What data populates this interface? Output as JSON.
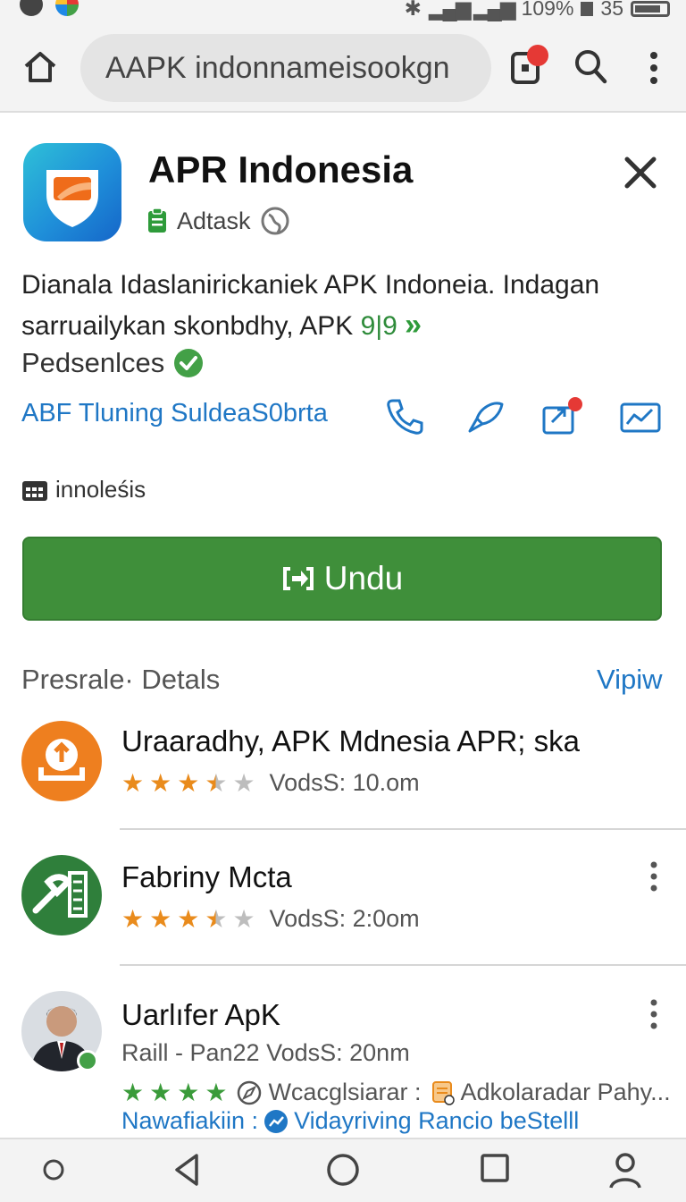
{
  "status_bar": {
    "battery_text": "109%",
    "time_text": "35"
  },
  "browser": {
    "url_text": "AAPK indonnameisookgn"
  },
  "app": {
    "title": "APR Indonesia",
    "developer": "Adtask",
    "description": "Dianala Idaslanirickaniek APK Indoneia. Indagan sarruailykan skonbdhy, APK",
    "description_highlight": "9|9",
    "badge_text": "Pedsenlces",
    "link_text": "ABF Tluning SuldeaS0brta",
    "language": "innoleśis",
    "install_label": "Undu"
  },
  "section": {
    "title": "Presrale· Detals",
    "link": "Vipiw"
  },
  "items": [
    {
      "title": "Uraaradhy, APK Mdnesia APR; ska",
      "rating": 3.5,
      "meta": "VodsS: 10.om"
    },
    {
      "title": "Fabriny Mcta",
      "rating": 3.5,
      "meta": "VodsS: 2:0om"
    },
    {
      "title": "Uarlıfer ApK",
      "subtitle": "Raill - Pan22  VodsS: 20nm",
      "rating": 4,
      "extra1": "Wcacglsiarar :",
      "extra2": "Adkolaradar Pahy...",
      "line_label": "Nawafiakiin :",
      "line_value": "Vidayriving Rancio beStelll"
    }
  ],
  "colors": {
    "accent_blue": "#1f77c5",
    "install_green": "#3f8f3a",
    "star_orange": "#e98b1c",
    "check_green": "#43a047",
    "badge_red": "#e53935"
  }
}
